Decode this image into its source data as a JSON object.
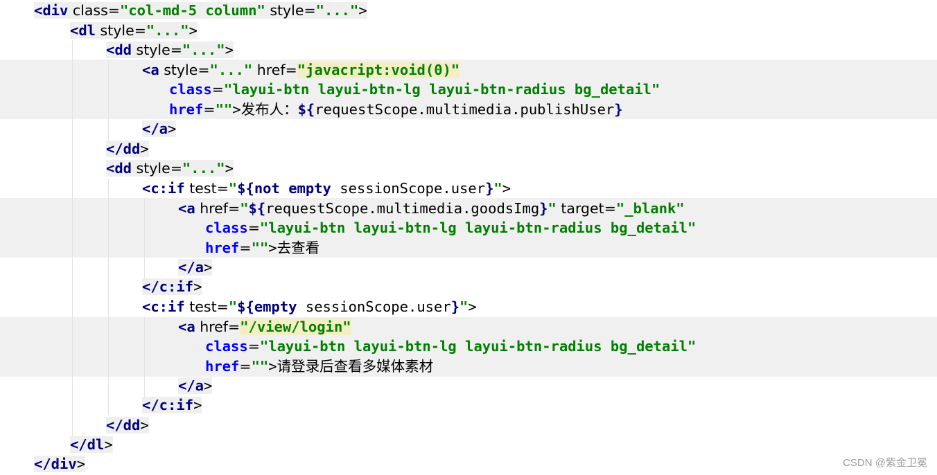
{
  "code_lines": [
    "<div class=\"col-md-5 column\" style=\"...\">",
    "<dl style=\"...\">",
    "<dd style=\"...\">",
    "<a style=\"...\" href=\"javacript:void(0)\"",
    "class=\"layui-btn layui-btn-lg layui-btn-radius bg_detail\"",
    "href=\"\">发布人：${requestScope.multimedia.publishUser}",
    "</a>",
    "</dd>",
    "<dd style=\"...\">",
    "<c:if test=\"${not empty sessionScope.user}\">",
    "<a href=\"${requestScope.multimedia.goodsImg}\" target=\"_blank\"",
    "class=\"layui-btn layui-btn-lg layui-btn-radius bg_detail\"",
    "href=\"\">去查看",
    "</a>",
    "</c:if>",
    "<c:if test=\"${empty sessionScope.user}\">",
    "<a href=\"/view/login\"",
    "class=\"layui-btn layui-btn-lg layui-btn-radius bg_detail\"",
    "href=\"\">请登录后查看多媒体素材",
    "</a>",
    "</c:if>",
    "</dd>",
    "</dl>",
    "</div>"
  ],
  "watermark": "CSDN @紫金卫冕"
}
